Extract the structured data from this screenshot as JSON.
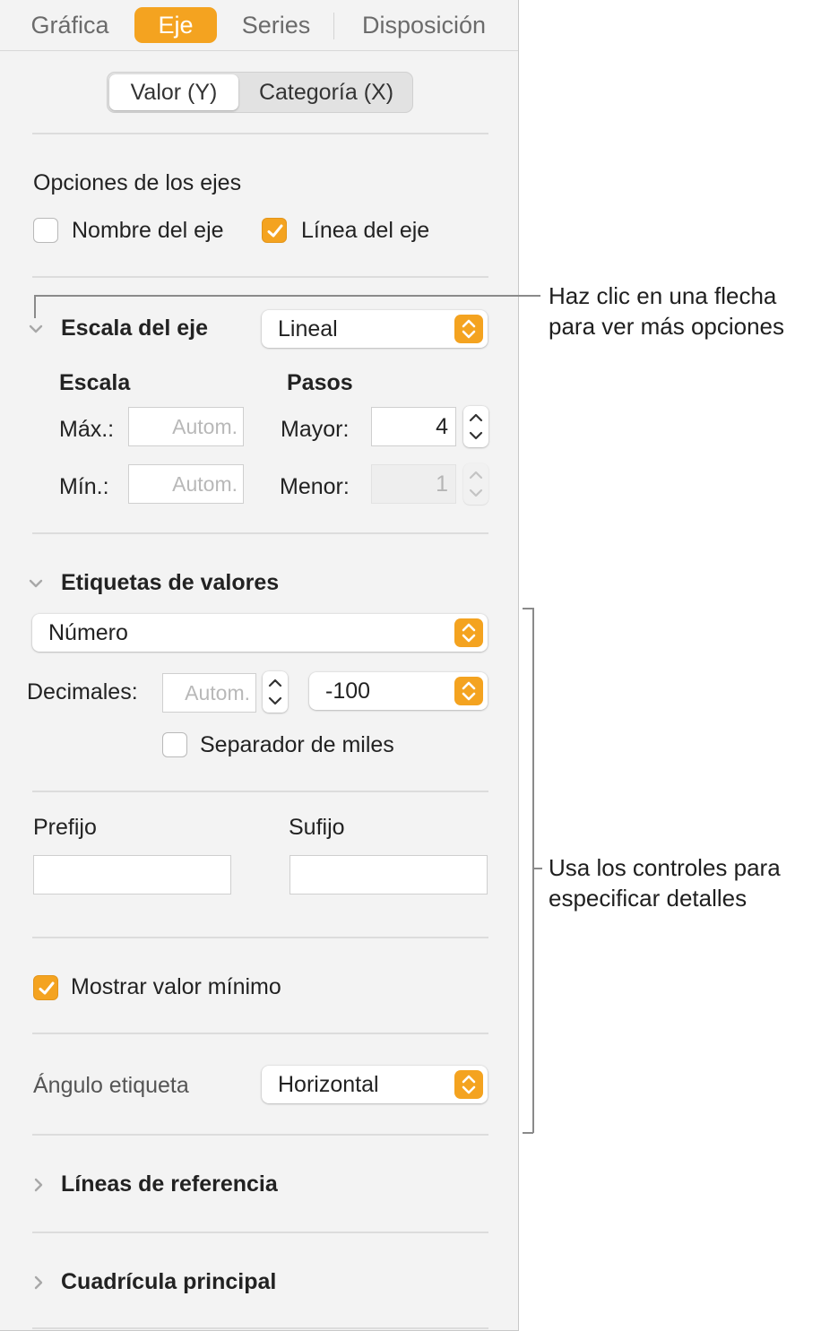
{
  "tabs": [
    {
      "label": "Gráfica",
      "active": false
    },
    {
      "label": "Eje",
      "active": true
    },
    {
      "label": "Series",
      "active": false
    },
    {
      "label": "Disposición",
      "active": false
    }
  ],
  "axis_segment": {
    "value_label": "Valor (Y)",
    "category_label": "Categoría (X)",
    "selected": "Valor (Y)"
  },
  "axis_options": {
    "title": "Opciones de los ejes",
    "axis_name": {
      "label": "Nombre del eje",
      "checked": false
    },
    "axis_line": {
      "label": "Línea del eje",
      "checked": true
    }
  },
  "axis_scale": {
    "title": "Escala del eje",
    "scale_type": "Lineal",
    "scale_heading": "Escala",
    "steps_heading": "Pasos",
    "max_label": "Máx.:",
    "max_placeholder": "Autom.",
    "min_label": "Mín.:",
    "min_placeholder": "Autom.",
    "major_label": "Mayor:",
    "major_value": "4",
    "minor_label": "Menor:",
    "minor_value": "1"
  },
  "value_labels": {
    "title": "Etiquetas de valores",
    "format": "Número",
    "decimals_label": "Decimales:",
    "decimals_placeholder": "Autom.",
    "negative_format": "-100",
    "thousands": {
      "label": "Separador de miles",
      "checked": false
    },
    "prefix_label": "Prefijo",
    "prefix_value": "",
    "suffix_label": "Sufijo",
    "suffix_value": "",
    "show_min": {
      "label": "Mostrar valor mínimo",
      "checked": true
    },
    "angle_label": "Ángulo etiqueta",
    "angle_value": "Horizontal"
  },
  "reference_lines": {
    "title": "Líneas de referencia"
  },
  "major_grid": {
    "title": "Cuadrícula principal"
  },
  "callouts": {
    "arrow_line1": "Haz clic en una flecha",
    "arrow_line2": "para ver más opciones",
    "controls_line1": "Usa los controles para",
    "controls_line2": "especificar detalles"
  },
  "colors": {
    "accent": "#f4a320",
    "panel": "#f3f3f3"
  }
}
